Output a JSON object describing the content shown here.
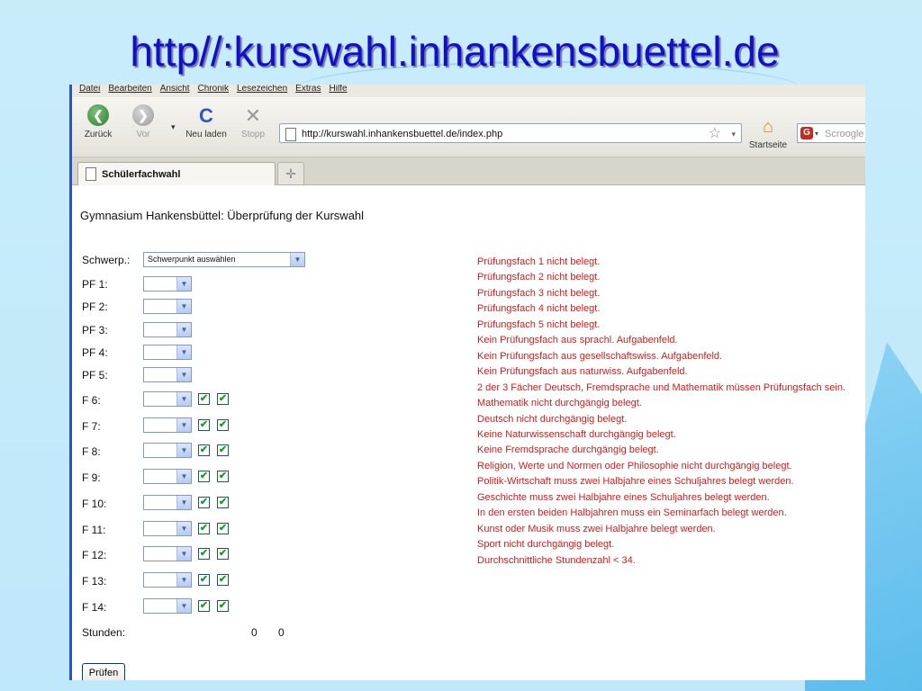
{
  "slide": {
    "title": "http//:kurswahl.inhankensbuettel.de"
  },
  "browser": {
    "menu": [
      "Datei",
      "Bearbeiten",
      "Ansicht",
      "Chronik",
      "Lesezeichen",
      "Extras",
      "Hilfe"
    ],
    "buttons": {
      "back": "Zurück",
      "forward": "Vor",
      "reload": "Neu laden",
      "stop": "Stopp",
      "home": "Startseite"
    },
    "url": "http://kurswahl.inhankensbuettel.de/index.php",
    "search_placeholder": "Scroogle ",
    "tab_title": "Schülerfachwahl"
  },
  "page": {
    "heading": "Gymnasium Hankensbüttel: Überprüfung der Kurswahl",
    "schwerpunkt": {
      "label": "Schwerp.:",
      "value": "Schwerpunkt auswählen"
    },
    "pf_labels": [
      "PF 1:",
      "PF 2:",
      "PF 3:",
      "PF 4:",
      "PF 5:"
    ],
    "f_labels": [
      "F 6:",
      "F 7:",
      "F 8:",
      "F 9:",
      "F 10:",
      "F 11:",
      "F 12:",
      "F 13:",
      "F 14:"
    ],
    "hours_label": "Stunden:",
    "hours_values": [
      "0",
      "0"
    ],
    "check_button": "Prüfen",
    "errors": [
      "Prüfungsfach 1 nicht belegt.",
      "Prüfungsfach 2 nicht belegt.",
      "Prüfungsfach 3 nicht belegt.",
      "Prüfungsfach 4 nicht belegt.",
      "Prüfungsfach 5 nicht belegt.",
      "Kein Prüfungsfach aus sprachl. Aufgabenfeld.",
      "Kein Prüfungsfach aus gesellschaftswiss. Aufgabenfeld.",
      "Kein Prüfungsfach aus naturwiss. Aufgabenfeld.",
      "2 der 3 Fächer Deutsch, Fremdsprache und Mathematik müssen Prüfungsfach sein.",
      "Mathematik nicht durchgängig belegt.",
      "Deutsch nicht durchgängig belegt.",
      "Keine Naturwissenschaft durchgängig belegt.",
      "Keine Fremdsprache durchgängig belegt.",
      "Religion, Werte und Normen oder Philosophie nicht durchgängig belegt.",
      "Politik-Wirtschaft muss zwei Halbjahre eines Schuljahres belegt werden.",
      "Geschichte muss zwei Halbjahre eines Schuljahres belegt werden.",
      "In den ersten beiden Halbjahren muss ein Seminarfach belegt werden.",
      "Kunst oder Musik muss zwei Halbjahre belegt werden.",
      "Sport nicht durchgängig belegt.",
      "Durchschnittliche Stundenzahl < 34."
    ]
  },
  "colors": {
    "title": "#1010c8",
    "error_text": "#d41b1b",
    "checkmark": "#1a9f1a"
  }
}
